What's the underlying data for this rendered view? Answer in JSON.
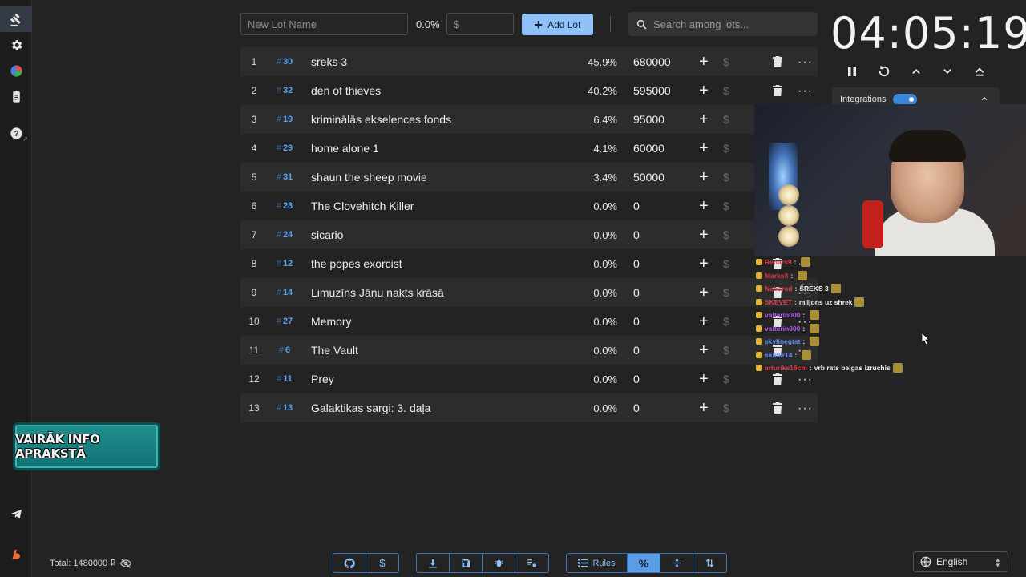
{
  "colors": {
    "accent": "#90c2f9",
    "background": "#232323",
    "row_alt": "#2c2c2c",
    "id_blue": "#5aa2f0"
  },
  "sidebar": {
    "items": [
      {
        "icon": "gavel-icon"
      },
      {
        "icon": "gear-icon"
      },
      {
        "icon": "pie-chart-icon"
      },
      {
        "icon": "clipboard-icon"
      },
      {
        "icon": "help-icon"
      },
      {
        "icon": "telegram-icon"
      },
      {
        "icon": "boosty-icon"
      }
    ]
  },
  "toolbar": {
    "new_lot_placeholder": "New Lot Name",
    "percent": "0.0%",
    "amount_placeholder": "$",
    "add_lot_label": "Add Lot",
    "search_placeholder": "Search among lots..."
  },
  "lots": [
    {
      "index": "1",
      "id": "30",
      "name": "sreks 3",
      "percent": "45.9%",
      "amount": "680000"
    },
    {
      "index": "2",
      "id": "32",
      "name": "den of thieves",
      "percent": "40.2%",
      "amount": "595000"
    },
    {
      "index": "3",
      "id": "19",
      "name": "kriminālās ekselences fonds",
      "percent": "6.4%",
      "amount": "95000"
    },
    {
      "index": "4",
      "id": "29",
      "name": "home alone 1",
      "percent": "4.1%",
      "amount": "60000"
    },
    {
      "index": "5",
      "id": "31",
      "name": "shaun the sheep movie",
      "percent": "3.4%",
      "amount": "50000"
    },
    {
      "index": "6",
      "id": "28",
      "name": "The Clovehitch Killer",
      "percent": "0.0%",
      "amount": "0"
    },
    {
      "index": "7",
      "id": "24",
      "name": "sicario",
      "percent": "0.0%",
      "amount": "0"
    },
    {
      "index": "8",
      "id": "12",
      "name": "the popes exorcist",
      "percent": "0.0%",
      "amount": "0"
    },
    {
      "index": "9",
      "id": "14",
      "name": "Limuzīns Jāņu nakts krāsā",
      "percent": "0.0%",
      "amount": "0"
    },
    {
      "index": "10",
      "id": "27",
      "name": "Memory",
      "percent": "0.0%",
      "amount": "0"
    },
    {
      "index": "11",
      "id": "6",
      "name": "The Vault",
      "percent": "0.0%",
      "amount": "0"
    },
    {
      "index": "12",
      "id": "11",
      "name": "Prey",
      "percent": "0.0%",
      "amount": "0"
    },
    {
      "index": "13",
      "id": "13",
      "name": "Galaktikas sargi: 3. daļa",
      "percent": "0.0%",
      "amount": "0"
    }
  ],
  "timer": {
    "value": "04:05:19"
  },
  "integrations": {
    "label": "Integrations"
  },
  "chat": [
    {
      "user": "Renars9",
      "user_color": "#e23b4f",
      "msg": ""
    },
    {
      "user": "Marks8",
      "user_color": "#e23b4f",
      "msg": ""
    },
    {
      "user": "Nebured",
      "user_color": "#e23b4f",
      "msg": "ŠREKS 3"
    },
    {
      "user": "SKEVET",
      "user_color": "#e23b4f",
      "msg": "miljons uz shrek"
    },
    {
      "user": "valterin000",
      "user_color": "#b15cf2",
      "msg": ""
    },
    {
      "user": "valterin000",
      "user_color": "#b15cf2",
      "msg": ""
    },
    {
      "user": "skylinegtst",
      "user_color": "#5f8cff",
      "msg": ""
    },
    {
      "user": "skidkr14",
      "user_color": "#5f8cff",
      "msg": ""
    },
    {
      "user": "arturiks19cm",
      "user_color": "#e23b4f",
      "msg": "vrb rats beigas izruchis"
    }
  ],
  "promo": {
    "text": "VAIRĀK INFO APRAKSTĀ"
  },
  "footer": {
    "total": "Total: 1480000 ₽",
    "rules_label": "Rules",
    "language": "English"
  }
}
